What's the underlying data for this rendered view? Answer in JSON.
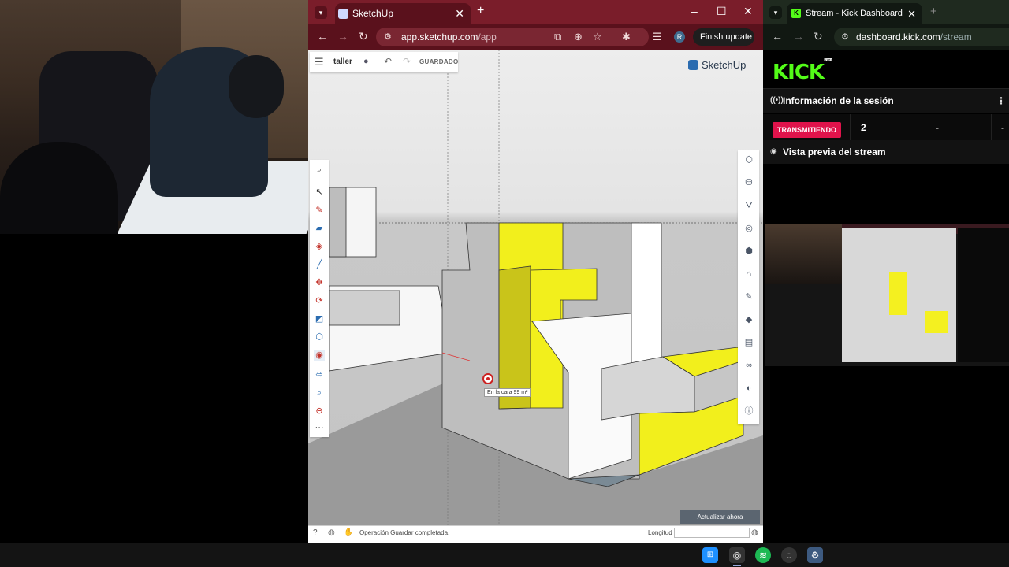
{
  "sketchup_browser": {
    "tab_title": "SketchUp",
    "url_host": "app.sketchup.com",
    "url_path": "/app",
    "profile_initial": "R",
    "finish_update_label": "Finish update"
  },
  "sketchup_app": {
    "project_name": "taller",
    "saved_label": "GUARDADO",
    "logo_text": "SketchUp",
    "tooltip_text": "En la cara 99 m²",
    "update_now_label": "Actualizar ahora",
    "status_message": "Operación Guardar completada.",
    "length_label": "Longitud",
    "length_value": ""
  },
  "kick_browser": {
    "tab_title": "Stream - Kick Dashboard",
    "url_host": "dashboard.kick.com",
    "url_path": "/stream"
  },
  "kick_dashboard": {
    "logo_text": "KICK",
    "logo_tag": "BETA",
    "session_info_title": "Información de la sesión",
    "live_badge": "TRANSMITIENDO",
    "stat_viewers": "2",
    "stat_2": "-",
    "stat_3": "-",
    "preview_title": "Vista previa del stream"
  },
  "colors": {
    "sketchup_tab_bg": "#7a1d2a",
    "kick_green": "#53fc18",
    "live_badge": "#e0134b",
    "model_yellow": "#f4f020"
  },
  "icons": {
    "left_tools": [
      "search-icon",
      "select-arrow-icon",
      "pencil-icon",
      "eraser-icon",
      "paint-bucket-icon",
      "line-icon",
      "move-icon",
      "rotate-icon",
      "scale-icon",
      "push-pull-icon",
      "tape-measure-icon",
      "orbit-icon",
      "zoom-icon",
      "section-plane-icon",
      "more-icon"
    ],
    "right_tools": [
      "entity-info-icon",
      "components-icon",
      "scenes-icon",
      "materials-icon",
      "styles-icon",
      "3d-warehouse-icon",
      "outliner-icon",
      "tags-icon",
      "instructor-icon",
      "glasses-icon",
      "display-icon",
      "info-icon"
    ]
  }
}
